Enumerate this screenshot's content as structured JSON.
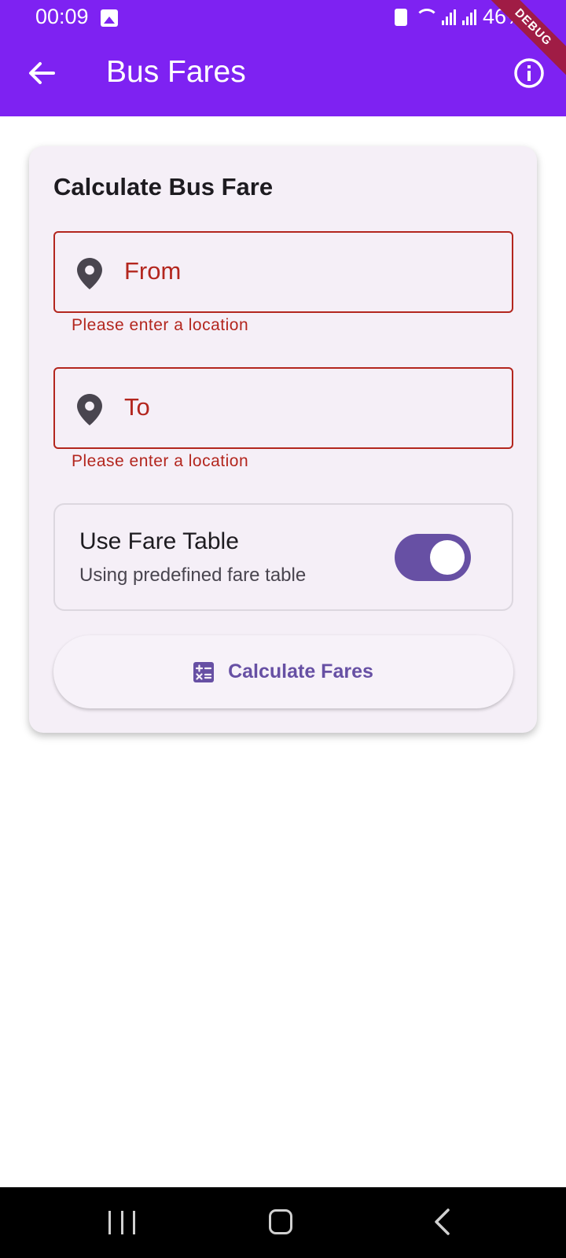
{
  "status_bar": {
    "time": "00:09",
    "battery": "46%"
  },
  "app_bar": {
    "title": "Bus Fares",
    "debug_label": "DEBUG",
    "icons": {
      "back": "arrow-left-icon",
      "info": "info-circle-icon"
    }
  },
  "card": {
    "title": "Calculate Bus Fare",
    "from_field": {
      "placeholder": "From",
      "error": "Please enter a location",
      "icon": "location-pin-icon"
    },
    "to_field": {
      "placeholder": "To",
      "error": "Please enter a location",
      "icon": "location-pin-icon"
    },
    "fare_table": {
      "title": "Use Fare Table",
      "subtitle": "Using predefined fare table",
      "enabled": true
    },
    "calculate_button": {
      "label": "Calculate Fares",
      "icon": "calculate-icon"
    }
  },
  "colors": {
    "app_bar": "#7e22f2",
    "error": "#b3261e",
    "primary": "#6750a4",
    "card_bg": "#f5eff7",
    "debug_ribbon": "#a01c45"
  }
}
